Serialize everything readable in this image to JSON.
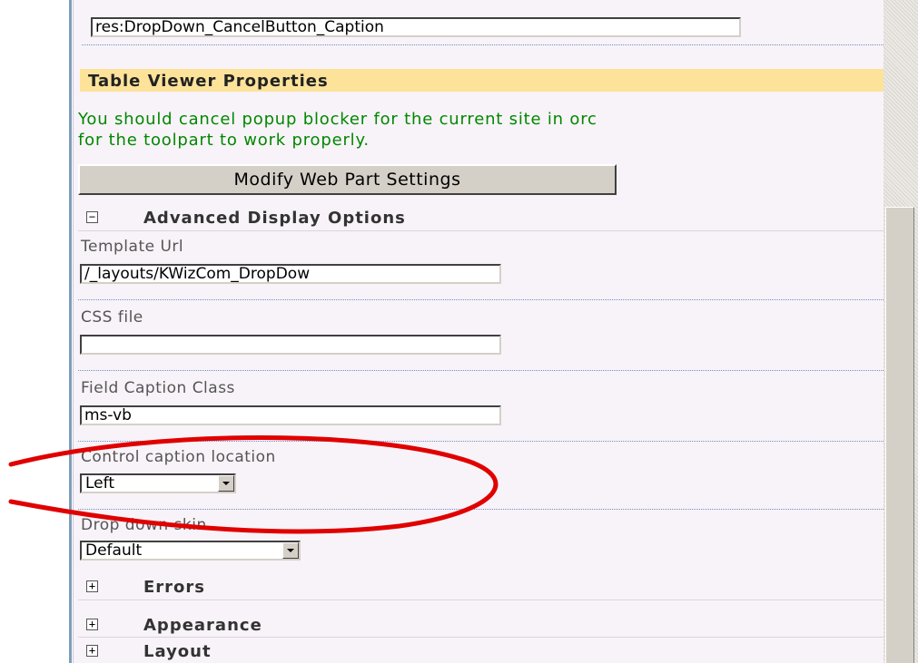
{
  "top_field": {
    "value": "res:DropDown_CancelButton_Caption"
  },
  "table_viewer": {
    "title": "Table Viewer Properties",
    "warning_line1": "You should cancel popup blocker for the current site in orc",
    "warning_line2": "for the toolpart to work properly.",
    "modify_button": "Modify Web Part Settings"
  },
  "advanced": {
    "toggle": "−",
    "title": "Advanced Display Options",
    "fields": [
      {
        "label": "Template Url",
        "value": "/_layouts/KWizCom_DropDow"
      },
      {
        "label": "CSS file",
        "value": ""
      },
      {
        "label": "Field Caption Class",
        "value": "ms-vb"
      }
    ],
    "caption_location": {
      "label": "Control caption location",
      "selected": "Left"
    },
    "skin": {
      "label": "Drop down skin",
      "selected": "Default"
    }
  },
  "collapsed_sections": [
    {
      "toggle": "+",
      "title": "Errors"
    },
    {
      "toggle": "+",
      "title": "Appearance"
    },
    {
      "toggle": "+",
      "title": "Layout"
    }
  ],
  "colors": {
    "panel_bg": "#f8f3f8",
    "header_bg": "#fde39a",
    "warning_text": "#008800",
    "annotation": "#e00000"
  }
}
